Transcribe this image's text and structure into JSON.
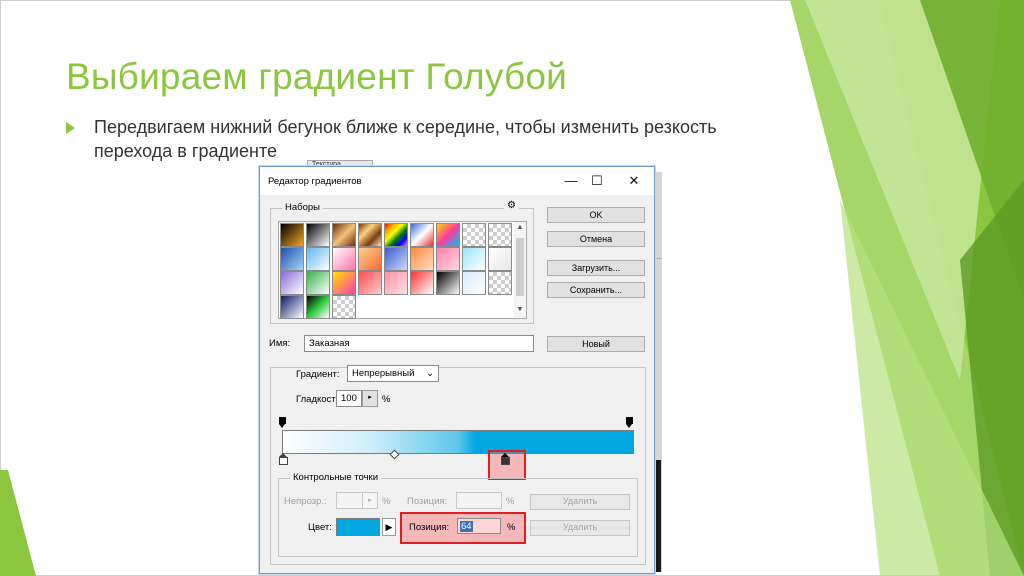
{
  "slide": {
    "title": "Выбираем градиент Голубой",
    "bullet": "Передвигаем нижний бегунок ближе к середине, чтобы изменить резкость перехода в градиенте",
    "accent_color": "#8cc63f"
  },
  "background_window": {
    "tab_label": "Текстура"
  },
  "dialog": {
    "title": "Редактор градиентов",
    "window_controls": {
      "minimize": "—",
      "maximize": "☐",
      "close": "✕"
    },
    "presets": {
      "legend": "Наборы",
      "gear_icon": "⚙",
      "scroll_up": "▲",
      "scroll_down": "▼"
    },
    "buttons": {
      "ok": "OK",
      "cancel": "Отмена",
      "load": "Загрузить...",
      "save": "Сохранить...",
      "new": "Новый"
    },
    "name": {
      "label": "Имя:",
      "value": "Заказная"
    },
    "gradient_type": {
      "label": "Градиент:",
      "value": "Непрерывный"
    },
    "smoothness": {
      "label": "Гладкость:",
      "value": "100",
      "unit": "%"
    },
    "stops": {
      "legend": "Контрольные точки",
      "opacity_label": "Непрозр.:",
      "opacity_unit": "%",
      "opacity_position_label": "Позиция:",
      "opacity_position_unit": "%",
      "delete_label": "Удалить",
      "color_label": "Цвет:",
      "color_value": "#00a8e2",
      "color_position_label": "Позиция:",
      "color_position_value": "64",
      "color_position_unit": "%",
      "delete_label_2": "Удалить"
    },
    "gradient_colors": [
      "#ffffff",
      "#00a8e2"
    ],
    "selected_color_stop_position_percent": 64
  }
}
